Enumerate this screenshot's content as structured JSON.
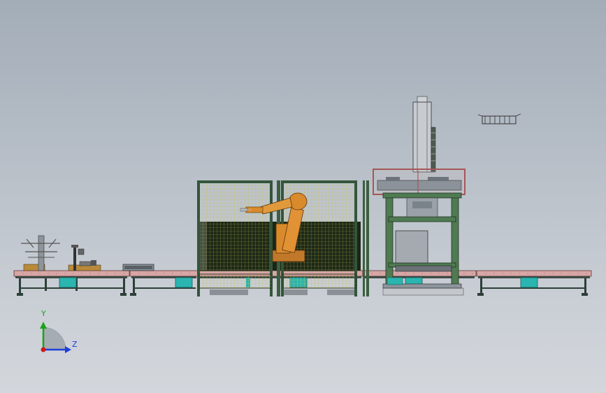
{
  "triad": {
    "y_label": "Y",
    "z_label": "Z",
    "colors": {
      "y": "#1aa31a",
      "z": "#1f3fd6",
      "origin": "#d01818"
    }
  },
  "colors": {
    "background_top": "#a3adb8",
    "background_bottom": "#d3d7dc",
    "conveyor_top": "#d8a6a6",
    "conveyor_frame": "#2c3f38",
    "cabinet": "#2ab5b0",
    "fence_mesh": "#c8c24a",
    "fence_frame": "#34553a",
    "robot": "#d98a2a",
    "press_frame": "#4f7a52",
    "guard": "#a85656"
  }
}
